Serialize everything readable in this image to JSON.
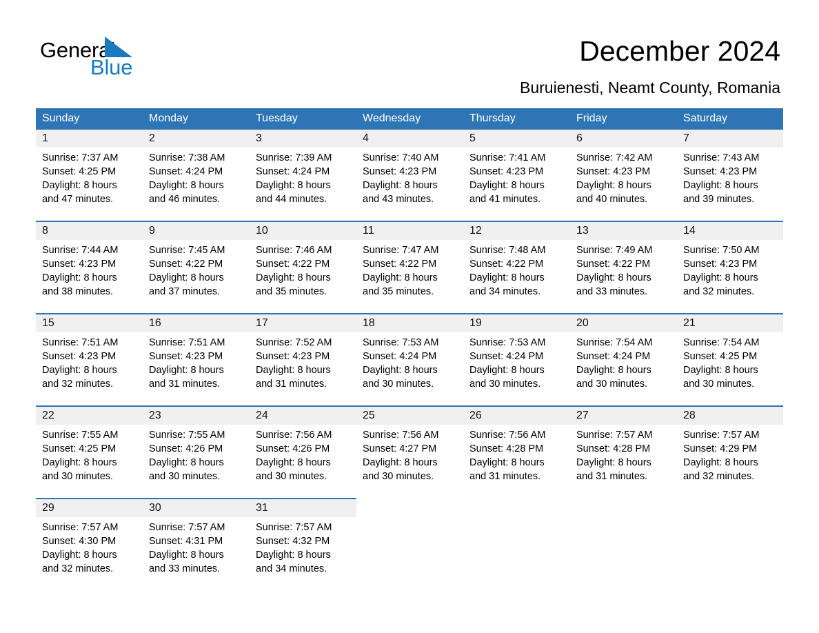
{
  "brand": {
    "name_part1": "General",
    "name_part2": "Blue",
    "triangle_color": "#1a7ac0",
    "logo_icon": "triangle-icon"
  },
  "header": {
    "title": "December 2024",
    "subtitle": "Buruienesti, Neamt County, Romania",
    "accent_color": "#2e75b6",
    "daynum_band_color": "#f0f0f0"
  },
  "calendar": {
    "weekdays": [
      "Sunday",
      "Monday",
      "Tuesday",
      "Wednesday",
      "Thursday",
      "Friday",
      "Saturday"
    ],
    "weeks": [
      [
        {
          "day": "1",
          "sunrise": "Sunrise: 7:37 AM",
          "sunset": "Sunset: 4:25 PM",
          "daylight_line1": "Daylight: 8 hours",
          "daylight_line2": "and 47 minutes."
        },
        {
          "day": "2",
          "sunrise": "Sunrise: 7:38 AM",
          "sunset": "Sunset: 4:24 PM",
          "daylight_line1": "Daylight: 8 hours",
          "daylight_line2": "and 46 minutes."
        },
        {
          "day": "3",
          "sunrise": "Sunrise: 7:39 AM",
          "sunset": "Sunset: 4:24 PM",
          "daylight_line1": "Daylight: 8 hours",
          "daylight_line2": "and 44 minutes."
        },
        {
          "day": "4",
          "sunrise": "Sunrise: 7:40 AM",
          "sunset": "Sunset: 4:23 PM",
          "daylight_line1": "Daylight: 8 hours",
          "daylight_line2": "and 43 minutes."
        },
        {
          "day": "5",
          "sunrise": "Sunrise: 7:41 AM",
          "sunset": "Sunset: 4:23 PM",
          "daylight_line1": "Daylight: 8 hours",
          "daylight_line2": "and 41 minutes."
        },
        {
          "day": "6",
          "sunrise": "Sunrise: 7:42 AM",
          "sunset": "Sunset: 4:23 PM",
          "daylight_line1": "Daylight: 8 hours",
          "daylight_line2": "and 40 minutes."
        },
        {
          "day": "7",
          "sunrise": "Sunrise: 7:43 AM",
          "sunset": "Sunset: 4:23 PM",
          "daylight_line1": "Daylight: 8 hours",
          "daylight_line2": "and 39 minutes."
        }
      ],
      [
        {
          "day": "8",
          "sunrise": "Sunrise: 7:44 AM",
          "sunset": "Sunset: 4:23 PM",
          "daylight_line1": "Daylight: 8 hours",
          "daylight_line2": "and 38 minutes."
        },
        {
          "day": "9",
          "sunrise": "Sunrise: 7:45 AM",
          "sunset": "Sunset: 4:22 PM",
          "daylight_line1": "Daylight: 8 hours",
          "daylight_line2": "and 37 minutes."
        },
        {
          "day": "10",
          "sunrise": "Sunrise: 7:46 AM",
          "sunset": "Sunset: 4:22 PM",
          "daylight_line1": "Daylight: 8 hours",
          "daylight_line2": "and 35 minutes."
        },
        {
          "day": "11",
          "sunrise": "Sunrise: 7:47 AM",
          "sunset": "Sunset: 4:22 PM",
          "daylight_line1": "Daylight: 8 hours",
          "daylight_line2": "and 35 minutes."
        },
        {
          "day": "12",
          "sunrise": "Sunrise: 7:48 AM",
          "sunset": "Sunset: 4:22 PM",
          "daylight_line1": "Daylight: 8 hours",
          "daylight_line2": "and 34 minutes."
        },
        {
          "day": "13",
          "sunrise": "Sunrise: 7:49 AM",
          "sunset": "Sunset: 4:22 PM",
          "daylight_line1": "Daylight: 8 hours",
          "daylight_line2": "and 33 minutes."
        },
        {
          "day": "14",
          "sunrise": "Sunrise: 7:50 AM",
          "sunset": "Sunset: 4:23 PM",
          "daylight_line1": "Daylight: 8 hours",
          "daylight_line2": "and 32 minutes."
        }
      ],
      [
        {
          "day": "15",
          "sunrise": "Sunrise: 7:51 AM",
          "sunset": "Sunset: 4:23 PM",
          "daylight_line1": "Daylight: 8 hours",
          "daylight_line2": "and 32 minutes."
        },
        {
          "day": "16",
          "sunrise": "Sunrise: 7:51 AM",
          "sunset": "Sunset: 4:23 PM",
          "daylight_line1": "Daylight: 8 hours",
          "daylight_line2": "and 31 minutes."
        },
        {
          "day": "17",
          "sunrise": "Sunrise: 7:52 AM",
          "sunset": "Sunset: 4:23 PM",
          "daylight_line1": "Daylight: 8 hours",
          "daylight_line2": "and 31 minutes."
        },
        {
          "day": "18",
          "sunrise": "Sunrise: 7:53 AM",
          "sunset": "Sunset: 4:24 PM",
          "daylight_line1": "Daylight: 8 hours",
          "daylight_line2": "and 30 minutes."
        },
        {
          "day": "19",
          "sunrise": "Sunrise: 7:53 AM",
          "sunset": "Sunset: 4:24 PM",
          "daylight_line1": "Daylight: 8 hours",
          "daylight_line2": "and 30 minutes."
        },
        {
          "day": "20",
          "sunrise": "Sunrise: 7:54 AM",
          "sunset": "Sunset: 4:24 PM",
          "daylight_line1": "Daylight: 8 hours",
          "daylight_line2": "and 30 minutes."
        },
        {
          "day": "21",
          "sunrise": "Sunrise: 7:54 AM",
          "sunset": "Sunset: 4:25 PM",
          "daylight_line1": "Daylight: 8 hours",
          "daylight_line2": "and 30 minutes."
        }
      ],
      [
        {
          "day": "22",
          "sunrise": "Sunrise: 7:55 AM",
          "sunset": "Sunset: 4:25 PM",
          "daylight_line1": "Daylight: 8 hours",
          "daylight_line2": "and 30 minutes."
        },
        {
          "day": "23",
          "sunrise": "Sunrise: 7:55 AM",
          "sunset": "Sunset: 4:26 PM",
          "daylight_line1": "Daylight: 8 hours",
          "daylight_line2": "and 30 minutes."
        },
        {
          "day": "24",
          "sunrise": "Sunrise: 7:56 AM",
          "sunset": "Sunset: 4:26 PM",
          "daylight_line1": "Daylight: 8 hours",
          "daylight_line2": "and 30 minutes."
        },
        {
          "day": "25",
          "sunrise": "Sunrise: 7:56 AM",
          "sunset": "Sunset: 4:27 PM",
          "daylight_line1": "Daylight: 8 hours",
          "daylight_line2": "and 30 minutes."
        },
        {
          "day": "26",
          "sunrise": "Sunrise: 7:56 AM",
          "sunset": "Sunset: 4:28 PM",
          "daylight_line1": "Daylight: 8 hours",
          "daylight_line2": "and 31 minutes."
        },
        {
          "day": "27",
          "sunrise": "Sunrise: 7:57 AM",
          "sunset": "Sunset: 4:28 PM",
          "daylight_line1": "Daylight: 8 hours",
          "daylight_line2": "and 31 minutes."
        },
        {
          "day": "28",
          "sunrise": "Sunrise: 7:57 AM",
          "sunset": "Sunset: 4:29 PM",
          "daylight_line1": "Daylight: 8 hours",
          "daylight_line2": "and 32 minutes."
        }
      ],
      [
        {
          "day": "29",
          "sunrise": "Sunrise: 7:57 AM",
          "sunset": "Sunset: 4:30 PM",
          "daylight_line1": "Daylight: 8 hours",
          "daylight_line2": "and 32 minutes."
        },
        {
          "day": "30",
          "sunrise": "Sunrise: 7:57 AM",
          "sunset": "Sunset: 4:31 PM",
          "daylight_line1": "Daylight: 8 hours",
          "daylight_line2": "and 33 minutes."
        },
        {
          "day": "31",
          "sunrise": "Sunrise: 7:57 AM",
          "sunset": "Sunset: 4:32 PM",
          "daylight_line1": "Daylight: 8 hours",
          "daylight_line2": "and 34 minutes."
        },
        {
          "day": "",
          "sunrise": "",
          "sunset": "",
          "daylight_line1": "",
          "daylight_line2": ""
        },
        {
          "day": "",
          "sunrise": "",
          "sunset": "",
          "daylight_line1": "",
          "daylight_line2": ""
        },
        {
          "day": "",
          "sunrise": "",
          "sunset": "",
          "daylight_line1": "",
          "daylight_line2": ""
        },
        {
          "day": "",
          "sunrise": "",
          "sunset": "",
          "daylight_line1": "",
          "daylight_line2": ""
        }
      ]
    ]
  }
}
